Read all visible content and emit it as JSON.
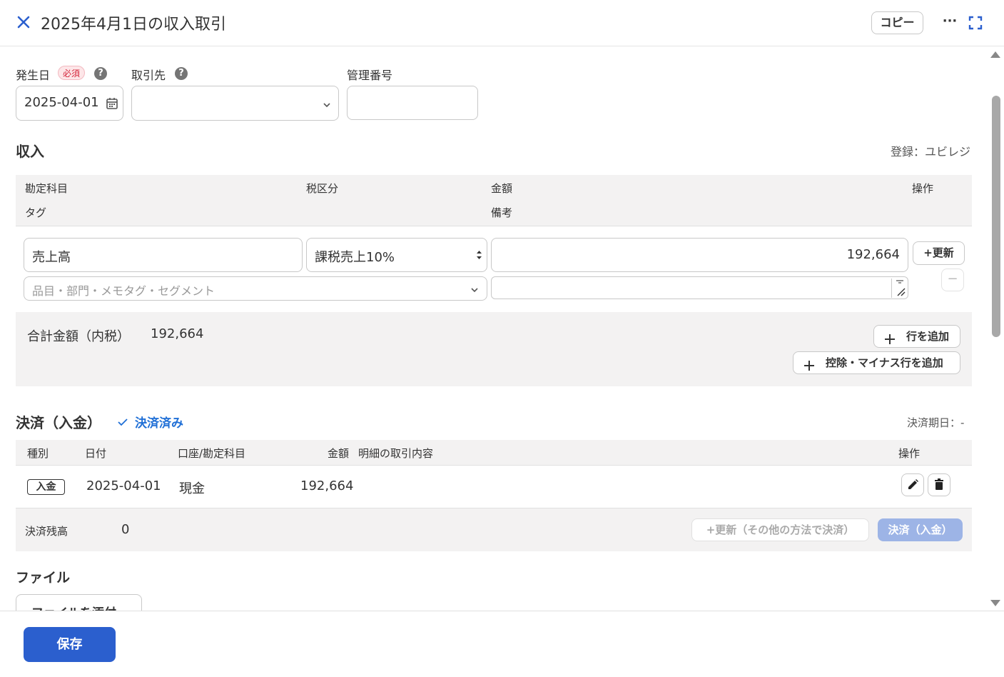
{
  "header": {
    "title": "2025年4月1日の収入取引",
    "copy_label": "コピー",
    "more_label": "···"
  },
  "form": {
    "date_label": "発生日",
    "required_badge": "必須",
    "date_value": "2025-04-01",
    "partner_label": "取引先",
    "partner_value": "",
    "ref_label": "管理番号",
    "ref_value": ""
  },
  "income": {
    "section_title": "収入",
    "registered_by": "登録：ユビレジ",
    "headers": {
      "account": "勘定科目",
      "tax": "税区分",
      "amount": "金額",
      "ops": "操作",
      "tag": "タグ",
      "note": "備考"
    },
    "row": {
      "account": "売上高",
      "tax": "課税売上10%",
      "amount": "192,664",
      "update_label": "+更新",
      "tags_placeholder": "品目・部門・メモタグ・セグメント",
      "note": "",
      "remove_label": "−"
    },
    "total_label": "合計金額（内税）",
    "total_value": "192,664",
    "add_row_label": "行を追加",
    "add_minus_row_label": "控除・マイナス行を追加"
  },
  "payment": {
    "section_title": "決済（入金）",
    "status": "決済済み",
    "due_label": "決済期日：-",
    "headers": {
      "type": "種別",
      "date": "日付",
      "account": "口座/勘定科目",
      "amount": "金額",
      "detail": "明細の取引内容",
      "ops": "操作"
    },
    "rows": [
      {
        "type": "入金",
        "date": "2025-04-01",
        "account": "現金",
        "amount": "192,664",
        "detail": ""
      }
    ],
    "balance_label": "決済残高",
    "balance_value": "0",
    "other_method_label": "+更新（その他の方法で決済）",
    "settle_label": "決済（入金）"
  },
  "files": {
    "section_title": "ファイル",
    "attach_label": "ファイルを添付"
  },
  "footer": {
    "save_label": "保存"
  },
  "colors": {
    "accent": "#2b5fce",
    "status_blue": "#1f6fd6",
    "required_red": "#d4253a",
    "panel_gray": "#f3f2f2",
    "settle_disabled": "#9db4e6"
  }
}
